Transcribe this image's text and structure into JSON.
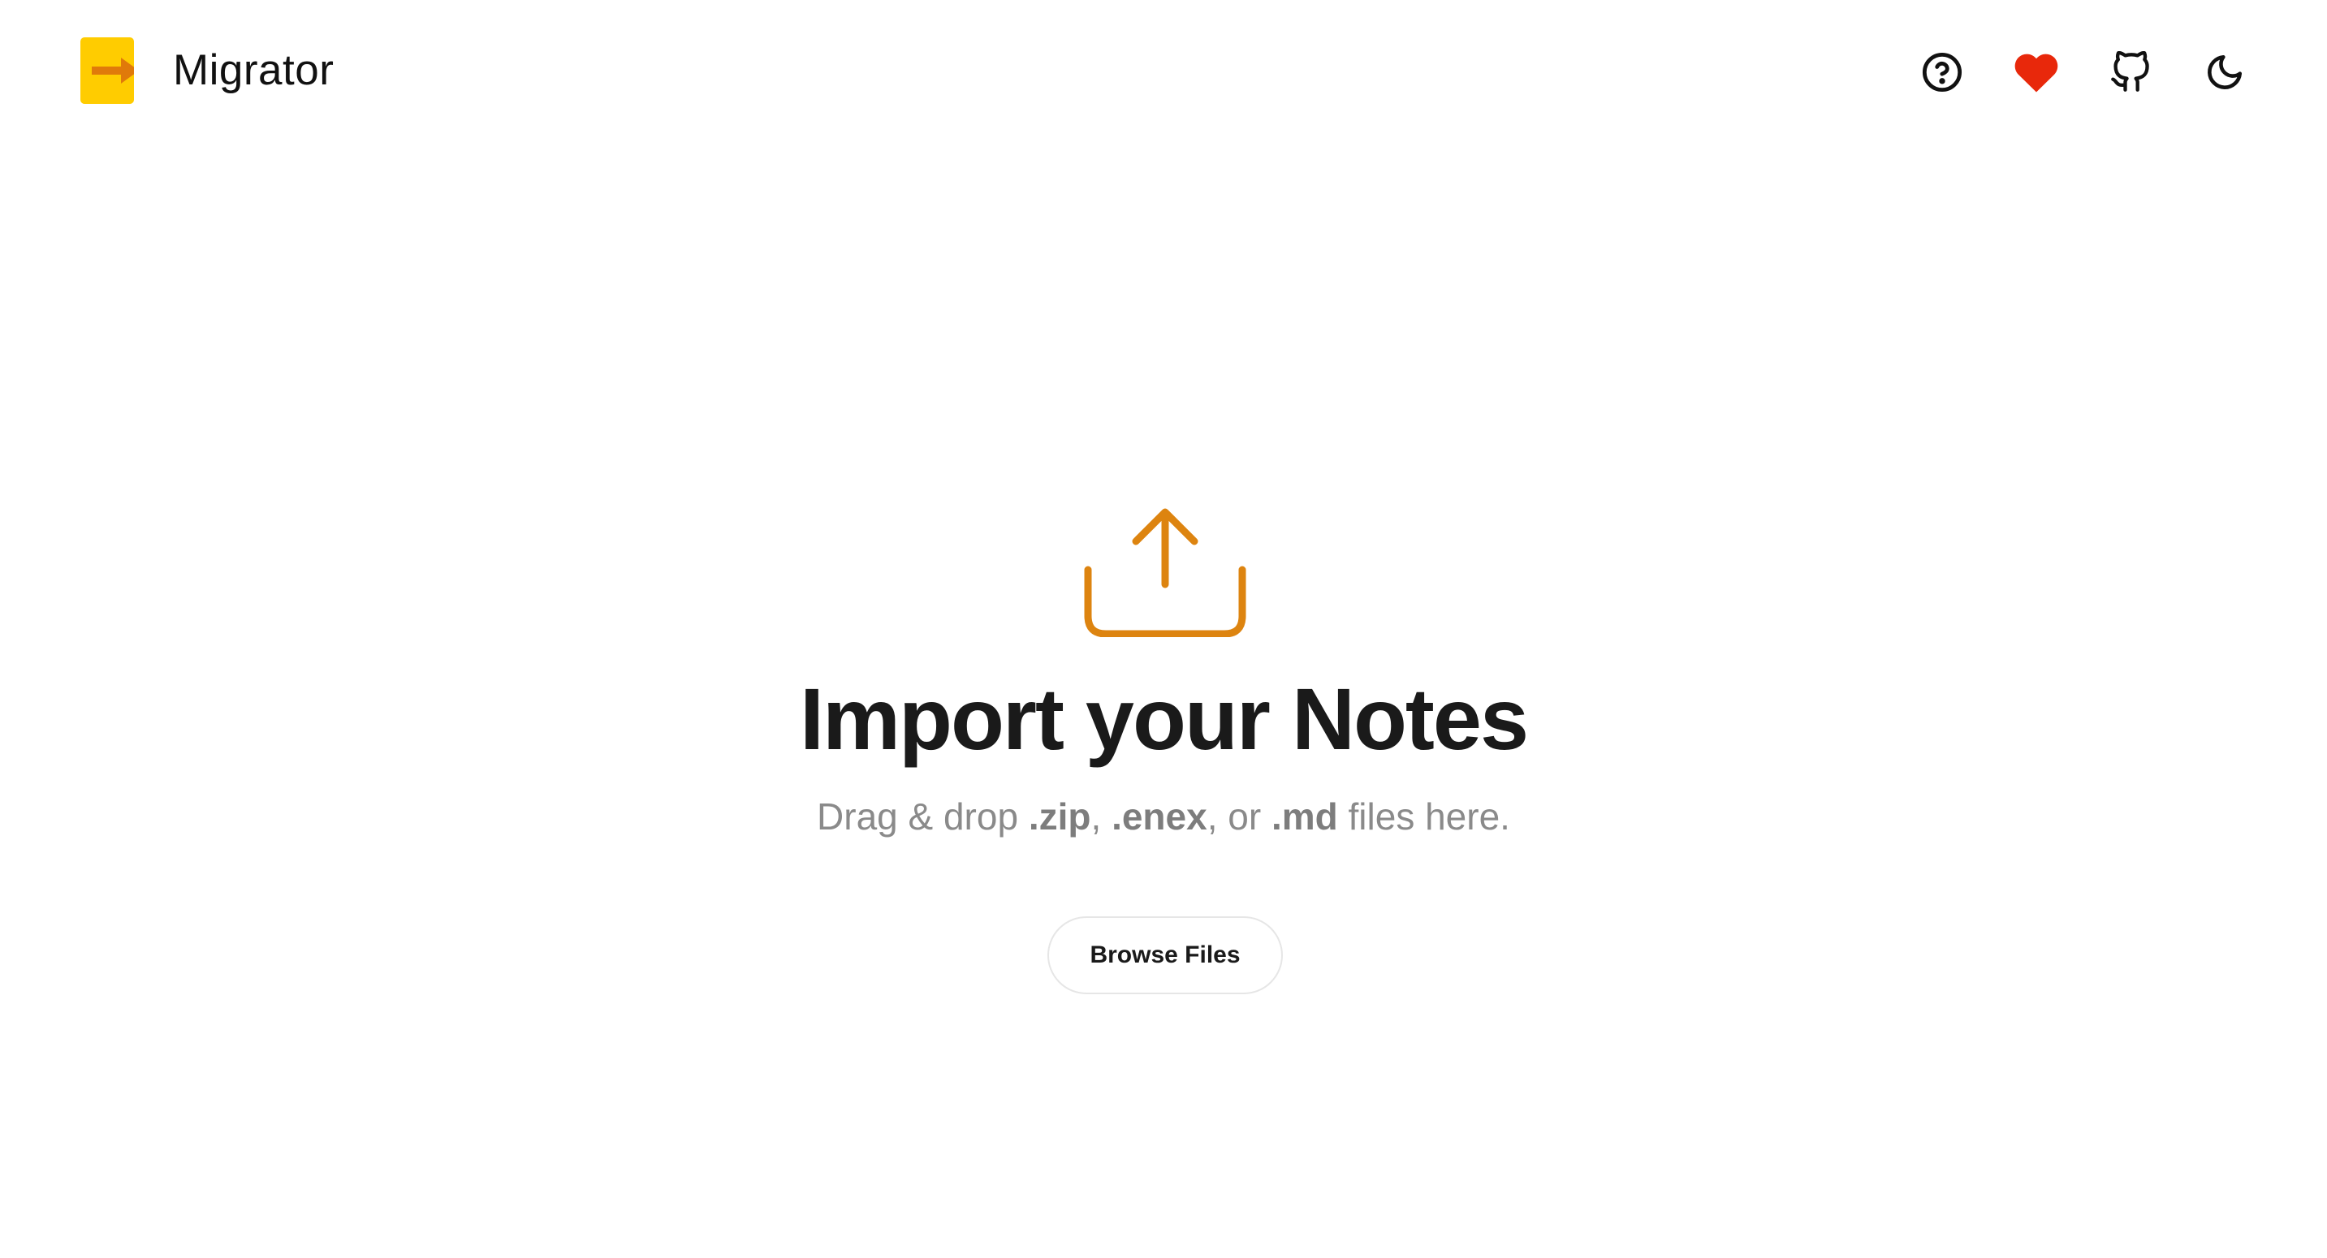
{
  "header": {
    "app_name": "Migrator",
    "actions": [
      {
        "icon": "help-circle-icon"
      },
      {
        "icon": "heart-icon",
        "color": "#e8280b"
      },
      {
        "icon": "github-icon"
      },
      {
        "icon": "moon-icon"
      }
    ]
  },
  "logo": {
    "icon": "arrow-right-icon",
    "background": "#ffcc00",
    "arrow_color": "#e07a0a"
  },
  "dropzone": {
    "icon": "upload-icon",
    "icon_color": "#dd8410",
    "title": "Import your Notes",
    "subtitle_prefix": "Drag & drop ",
    "ext_zip": ".zip",
    "sep_1": ", ",
    "ext_enex": ".enex",
    "sep_2": ", or ",
    "ext_md": ".md",
    "subtitle_suffix": " files here.",
    "browse_label": "Browse Files"
  }
}
